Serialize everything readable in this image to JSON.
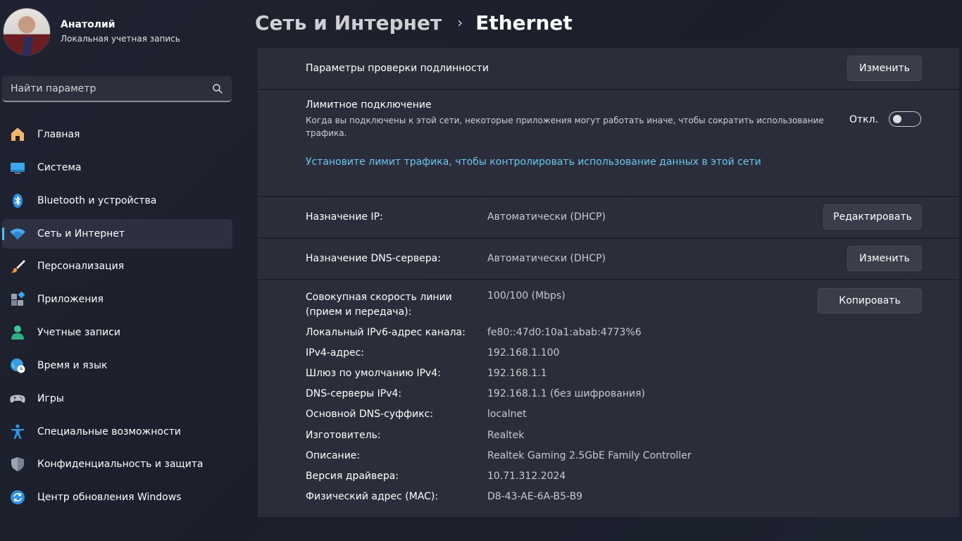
{
  "profile": {
    "name": "Анатолий",
    "account_type": "Локальная учетная запись"
  },
  "search": {
    "placeholder": "Найти параметр"
  },
  "sidebar": {
    "items": [
      {
        "label": "Главная",
        "icon": "home-icon"
      },
      {
        "label": "Система",
        "icon": "monitor-icon"
      },
      {
        "label": "Bluetooth и устройства",
        "icon": "bluetooth-icon"
      },
      {
        "label": "Сеть и Интернет",
        "icon": "wifi-icon",
        "active": true
      },
      {
        "label": "Персонализация",
        "icon": "brush-icon"
      },
      {
        "label": "Приложения",
        "icon": "apps-icon"
      },
      {
        "label": "Учетные записи",
        "icon": "person-icon"
      },
      {
        "label": "Время и язык",
        "icon": "globe-clock-icon"
      },
      {
        "label": "Игры",
        "icon": "gamepad-icon"
      },
      {
        "label": "Специальные возможности",
        "icon": "accessibility-icon"
      },
      {
        "label": "Конфиденциальность и защита",
        "icon": "shield-icon"
      },
      {
        "label": "Центр обновления Windows",
        "icon": "update-icon"
      }
    ]
  },
  "breadcrumb": {
    "parent": "Сеть и Интернет",
    "separator": "›",
    "current": "Ethernet"
  },
  "auth": {
    "label": "Параметры проверки подлинности",
    "button": "Изменить"
  },
  "metered": {
    "title": "Лимитное подключение",
    "description": "Когда вы подключены к этой сети, некоторые приложения могут работать иначе, чтобы сократить использование трафика.",
    "toggle_state": "Откл.",
    "link": "Установите лимит трафика, чтобы контролировать использование данных в этой сети"
  },
  "ip": {
    "label": "Назначение IP:",
    "value": "Автоматически (DHCP)",
    "button": "Редактировать"
  },
  "dns": {
    "label": "Назначение DNS-сервера:",
    "value": "Автоматически (DHCP)",
    "button": "Изменить"
  },
  "properties": {
    "copy_button": "Копировать",
    "speed_label_line1": "Совокупная скорость линии",
    "speed_label_line2": "(прием и передача):",
    "speed_value": "100/100 (Mbps)",
    "rows": [
      {
        "label": "Локальный IPv6-адрес канала:",
        "value": "fe80::47d0:10a1:abab:4773%6"
      },
      {
        "label": "IPv4-адрес:",
        "value": "192.168.1.100"
      },
      {
        "label": "Шлюз по умолчанию IPv4:",
        "value": "192.168.1.1"
      },
      {
        "label": "DNS-серверы IPv4:",
        "value": "192.168.1.1 (без шифрования)"
      },
      {
        "label": "Основной DNS-суффикс:",
        "value": "localnet"
      },
      {
        "label": "Изготовитель:",
        "value": "Realtek"
      },
      {
        "label": "Описание:",
        "value": "Realtek Gaming 2.5GbE Family Controller"
      },
      {
        "label": "Версия драйвера:",
        "value": "10.71.312.2024"
      },
      {
        "label": "Физический адрес (MAC):",
        "value": "D8-43-AE-6A-B5-B9"
      }
    ]
  },
  "colors": {
    "accent": "#4cc2ff",
    "link": "#6cc6f0",
    "card": "#2b2e3a"
  }
}
